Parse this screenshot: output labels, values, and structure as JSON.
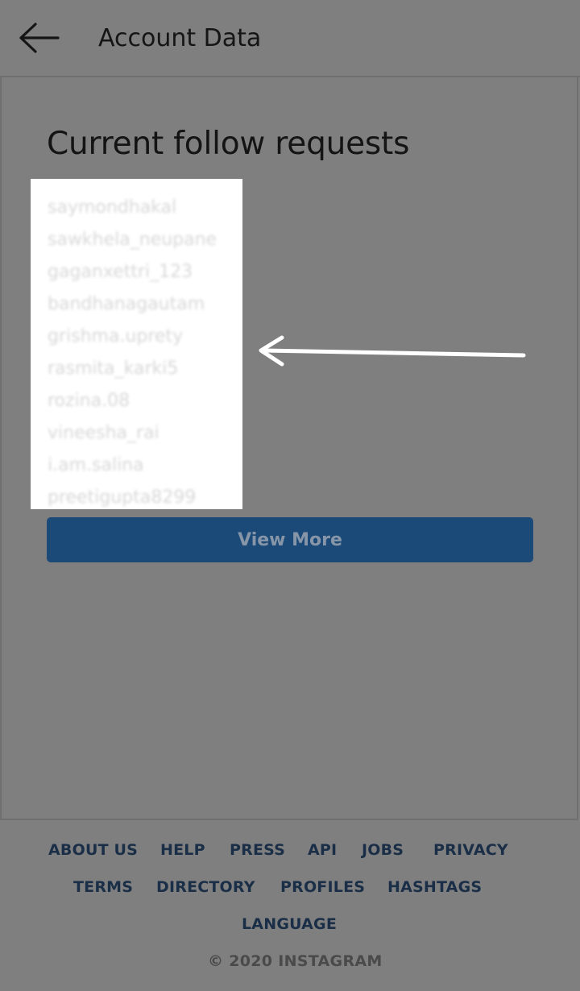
{
  "header": {
    "title": "Account Data"
  },
  "main": {
    "section_title": "Current follow requests",
    "requests": [
      "saymondhakal",
      "sawkhela_neupane",
      "gaganxettri_123",
      "bandhanagautam",
      "grishma.uprety",
      "rasmita_karki5",
      "rozina.08",
      "vineesha_rai",
      "i.am.salina",
      "preetigupta8299"
    ],
    "view_more_label": "View More"
  },
  "footer": {
    "links": [
      "ABOUT US",
      "HELP",
      "PRESS",
      "API",
      "JOBS",
      "PRIVACY",
      "TERMS",
      "DIRECTORY",
      "PROFILES",
      "HASHTAGS",
      "LANGUAGE"
    ],
    "copyright": "© 2020 INSTAGRAM"
  },
  "colors": {
    "overlay_gray": "#7f7f7f",
    "button_blue": "#1c4a78",
    "footer_link": "#1a2f47"
  },
  "icons": {
    "back": "arrow-left-icon",
    "annotation": "arrow-pointer-icon"
  }
}
